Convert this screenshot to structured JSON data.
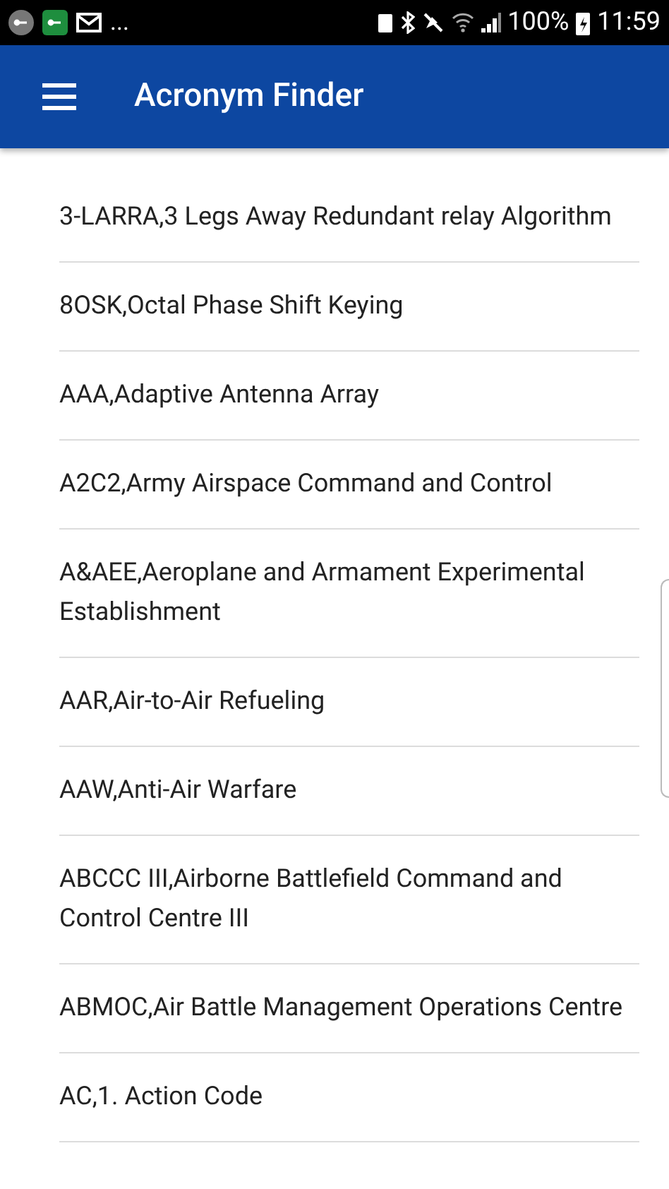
{
  "status_bar": {
    "overflow": "...",
    "battery": "100%",
    "time": "11:59"
  },
  "app_bar": {
    "title": "Acronym Finder"
  },
  "items": [
    {
      "text": "3-LARRA,3 Legs Away Redundant relay Algorithm"
    },
    {
      "text": "8OSK,Octal Phase Shift Keying"
    },
    {
      "text": "AAA,Adaptive Antenna Array"
    },
    {
      "text": "A2C2,Army Airspace Command and Control"
    },
    {
      "text": "A&AEE,Aeroplane and Armament Experimental Establishment"
    },
    {
      "text": "AAR,Air-to-Air Refueling"
    },
    {
      "text": "AAW,Anti-Air Warfare"
    },
    {
      "text": "ABCCC III,Airborne Battlefield Command and Control Centre III"
    },
    {
      "text": "ABMOC,Air Battle Management Operations Centre"
    },
    {
      "text": "AC,1. Action Code"
    }
  ]
}
